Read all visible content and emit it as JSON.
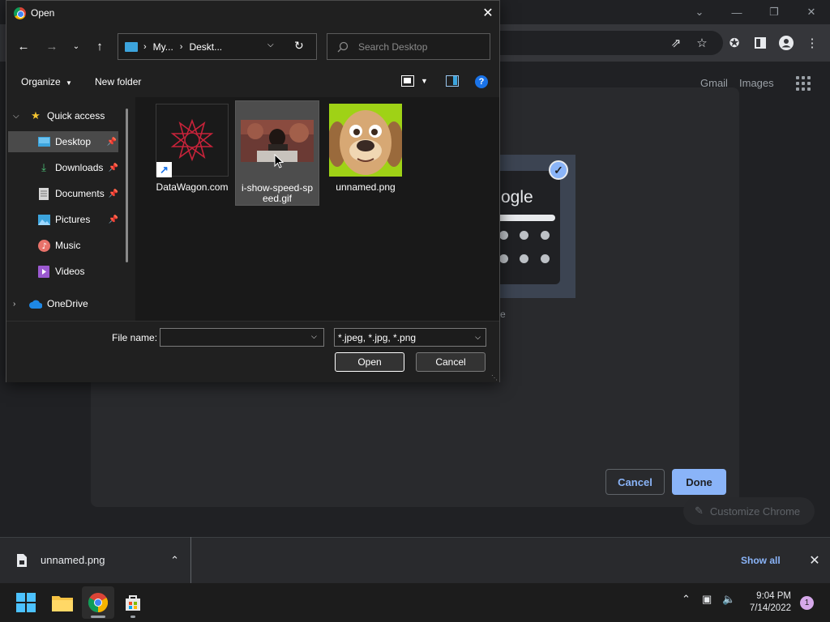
{
  "browser": {
    "header_links": {
      "gmail": "Gmail",
      "images": "Images"
    },
    "customize_modal": {
      "theme_logo_fragment": "ogle",
      "theme_caption_fragment": "e",
      "cancel_label": "Cancel",
      "done_label": "Done"
    },
    "customize_chrome_label": "Customize Chrome"
  },
  "dialog": {
    "title": "Open",
    "address": {
      "segments": [
        "My...",
        "Deskt..."
      ]
    },
    "search_placeholder": "Search Desktop",
    "commands": {
      "organize": "Organize",
      "new_folder": "New folder"
    },
    "nav_items": [
      {
        "label": "Quick access",
        "icon": "star-icon",
        "pinned": false
      },
      {
        "label": "Desktop",
        "icon": "desktop-folder-icon",
        "pinned": true,
        "selected": true
      },
      {
        "label": "Downloads",
        "icon": "download-icon",
        "pinned": true
      },
      {
        "label": "Documents",
        "icon": "document-icon",
        "pinned": true
      },
      {
        "label": "Pictures",
        "icon": "pictures-icon",
        "pinned": true
      },
      {
        "label": "Music",
        "icon": "music-icon",
        "pinned": false
      },
      {
        "label": "Videos",
        "icon": "video-icon",
        "pinned": false
      },
      {
        "label": "OneDrive",
        "icon": "cloud-icon",
        "pinned": false
      }
    ],
    "files": [
      {
        "name": "DataWagon.com",
        "type": "shortcut"
      },
      {
        "name": "i-show-speed-speed.gif",
        "name_lines": [
          "i-show-speed-sp",
          "eed.gif"
        ],
        "type": "gif",
        "selected": true
      },
      {
        "name": "unnamed.png",
        "type": "png"
      }
    ],
    "file_name_label": "File name:",
    "file_name_value": "",
    "file_type_filter": "*.jpeg, *.jpg, *.png",
    "open_label": "Open",
    "cancel_label": "Cancel"
  },
  "download_shelf": {
    "item_name": "unnamed.png",
    "show_all_label": "Show all"
  },
  "taskbar": {
    "time": "9:04 PM",
    "date": "7/14/2022",
    "notification_count": "1"
  },
  "colors": {
    "accent_blue": "#8ab4f8",
    "dialog_bg": "#202020",
    "selection": "#4d4d4d"
  }
}
